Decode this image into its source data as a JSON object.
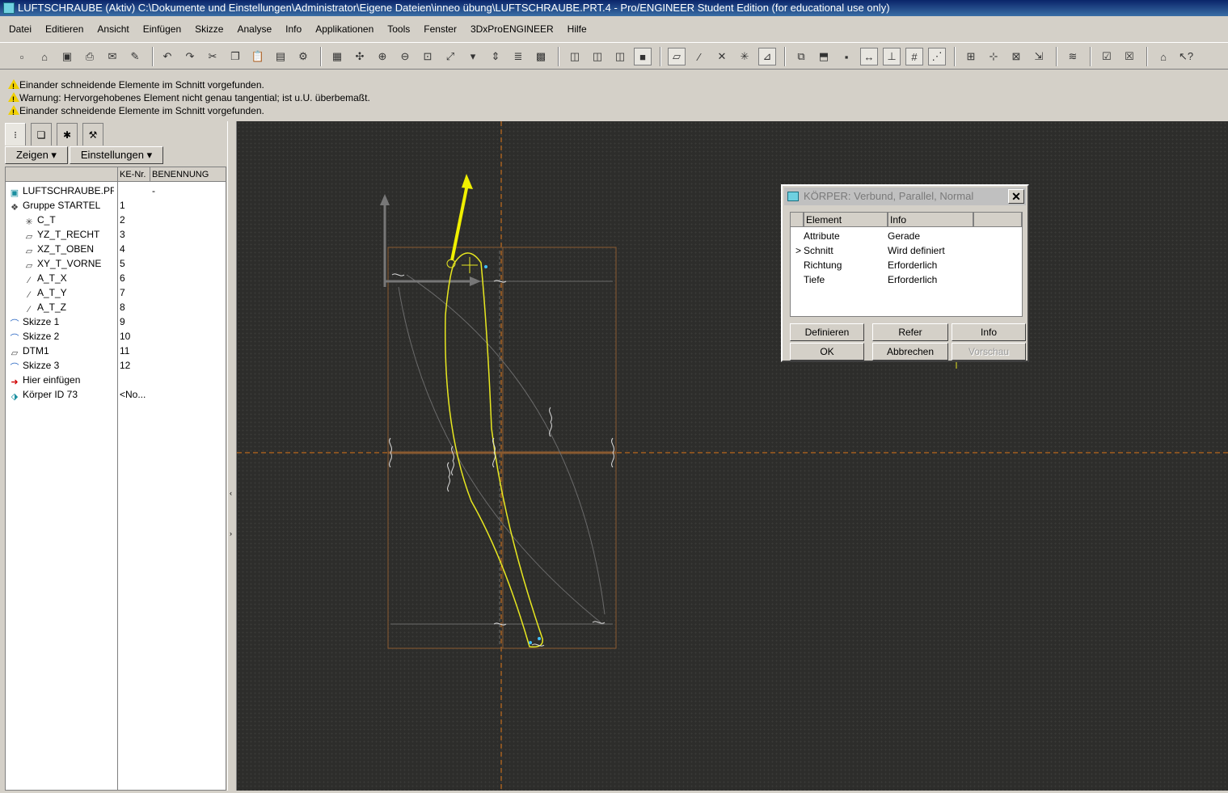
{
  "window": {
    "title": "LUFTSCHRAUBE (Aktiv) C:\\Dokumente und Einstellungen\\Administrator\\Eigene Dateien\\inneo übung\\LUFTSCHRAUBE.PRT.4 - Pro/ENGINEER Student Edition (for educational use only)"
  },
  "menu": [
    "Datei",
    "Editieren",
    "Ansicht",
    "Einfügen",
    "Skizze",
    "Analyse",
    "Info",
    "Applikationen",
    "Tools",
    "Fenster",
    "3DxProENGINEER",
    "Hilfe"
  ],
  "messages": [
    "Einander schneidende Elemente im Schnitt vorgefunden.",
    "Warnung: Hervorgehobenes Element nicht genau tangential; ist u.U. überbemaßt.",
    "Einander schneidende Elemente im Schnitt vorgefunden."
  ],
  "panel": {
    "show_button": "Zeigen",
    "settings_button": "Einstellungen",
    "col_nr": "KE-Nr.",
    "col_name": "BENENNUNG"
  },
  "tree": [
    {
      "name": "LUFTSCHRAUBE.PRT",
      "nr": "",
      "ben": "-",
      "icon": "part-icon"
    },
    {
      "name": "Gruppe STARTEL",
      "nr": "1",
      "ben": "",
      "icon": "group-icon"
    },
    {
      "name": "C_T",
      "nr": "2",
      "ben": "",
      "icon": "csys-icon"
    },
    {
      "name": "YZ_T_RECHT",
      "nr": "3",
      "ben": "",
      "icon": "datum-plane-icon"
    },
    {
      "name": "XZ_T_OBEN",
      "nr": "4",
      "ben": "",
      "icon": "datum-plane-icon"
    },
    {
      "name": "XY_T_VORNE",
      "nr": "5",
      "ben": "",
      "icon": "datum-plane-icon"
    },
    {
      "name": "A_T_X",
      "nr": "6",
      "ben": "",
      "icon": "axis-icon"
    },
    {
      "name": "A_T_Y",
      "nr": "7",
      "ben": "",
      "icon": "axis-icon"
    },
    {
      "name": "A_T_Z",
      "nr": "8",
      "ben": "",
      "icon": "axis-icon"
    },
    {
      "name": "Skizze 1",
      "nr": "9",
      "ben": "",
      "icon": "sketch-icon"
    },
    {
      "name": "Skizze 2",
      "nr": "10",
      "ben": "",
      "icon": "sketch-icon"
    },
    {
      "name": "DTM1",
      "nr": "11",
      "ben": "",
      "icon": "datum-plane-icon"
    },
    {
      "name": "Skizze 3",
      "nr": "12",
      "ben": "",
      "icon": "sketch-icon"
    },
    {
      "name": "Hier einfügen",
      "nr": "",
      "ben": "",
      "icon": "insert-arrow-icon"
    },
    {
      "name": "Körper ID 73",
      "nr": "<No...",
      "ben": "",
      "icon": "blend-feature-icon"
    }
  ],
  "dialog": {
    "title": "KÖRPER: Verbund, Parallel, Normal",
    "col_element": "Element",
    "col_info": "Info",
    "rows": [
      {
        "element": "Attribute",
        "info": "Gerade",
        "current": false
      },
      {
        "element": "Schnitt",
        "info": "Wird definiert",
        "current": true
      },
      {
        "element": "Richtung",
        "info": "Erforderlich",
        "current": false
      },
      {
        "element": "Tiefe",
        "info": "Erforderlich",
        "current": false
      }
    ],
    "current_marker": ">",
    "buttons": {
      "define": "Definieren",
      "refer": "Refer",
      "info": "Info",
      "ok": "OK",
      "cancel": "Abbrechen",
      "preview": "Vorschau"
    }
  },
  "colors": {
    "sketch": "#e8e820",
    "datum": "#e07818",
    "grid": "#7a7a7a",
    "background": "#2d2d2b"
  }
}
